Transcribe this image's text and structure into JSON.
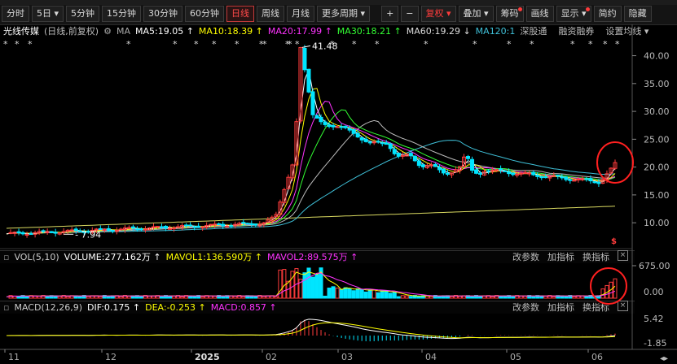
{
  "toolbar": {
    "buttons": [
      {
        "label": "分时"
      },
      {
        "label": "5日 ▾"
      },
      {
        "label": "5分钟"
      },
      {
        "label": "15分钟"
      },
      {
        "label": "30分钟"
      },
      {
        "label": "60分钟"
      },
      {
        "label": "日线",
        "active": true
      },
      {
        "label": "周线"
      },
      {
        "label": "月线"
      },
      {
        "label": "更多周期 ▾"
      }
    ],
    "tools": [
      {
        "label": "+"
      },
      {
        "label": "−"
      },
      {
        "label": "复权 ▾",
        "red": true
      },
      {
        "label": "叠加 ▾"
      },
      {
        "label": "筹码",
        "dot": true
      },
      {
        "label": "画线"
      },
      {
        "label": "显示 ▾",
        "dot": true
      },
      {
        "label": "简约"
      },
      {
        "label": "隐藏"
      }
    ]
  },
  "legend": {
    "stock": "光线传媒",
    "mode": "(日线,前复权)",
    "gear": "⚙",
    "ma": "MA",
    "ma5": "MA5:19.05 ↑",
    "ma10": "MA10:18.39 ↑",
    "ma20": "MA20:17.99 ↑",
    "ma30": "MA30:18.21 ↑",
    "ma60": "MA60:19.29 ↓",
    "ma120": "MA120:1",
    "t1": "深股通",
    "t2": "融资融券",
    "t3": "设置均线 ▾"
  },
  "vol_panel": {
    "name": "VOL(5,10)",
    "volume": "VOLUME:277.162万 ↑",
    "mavol1": "MAVOL1:136.590万 ↑",
    "mavol2": "MAVOL2:89.575万 ↑",
    "tools": [
      "改参数",
      "加指标",
      "换指标"
    ],
    "close": "×"
  },
  "macd_panel": {
    "name": "MACD(12,26,9)",
    "dif": "DIF:0.175 ↑",
    "dea": "DEA:-0.253 ↑",
    "macd": "MACD:0.857 ↑",
    "tools": [
      "改参数",
      "加指标",
      "换指标"
    ],
    "close": "×"
  },
  "annotations": {
    "high": "41.48",
    "low": "7.94",
    "s_marker": "$"
  },
  "colors": {
    "up": "#ff3c3c",
    "down": "#00e5ff",
    "ma5": "#ffffff",
    "ma10": "#ffff00",
    "ma20": "#ff33ff",
    "ma30": "#33ff33",
    "ma60": "#bbbbbb",
    "ma120": "#3fc0d8",
    "ma250": "#d8d860"
  },
  "chart_data": [
    {
      "type": "line",
      "subtype": "candlestick",
      "title": "光线传媒 (日线,前复权)",
      "x": [
        "11",
        "12",
        "2025",
        "02",
        "03",
        "04",
        "05",
        "06"
      ],
      "y_ticks": [
        "40.00",
        "35.00",
        "30.00",
        "25.00",
        "20.00",
        "15.00",
        "10.00"
      ],
      "ylim": [
        5.5,
        43
      ],
      "series": [
        {
          "name": "Close",
          "values": [
            8.3,
            8.6,
            9.0,
            9.1,
            9.3,
            9.6,
            10.0,
            16.5,
            41.48,
            28.0,
            25.5,
            23.5,
            23.2,
            22.0,
            19.5,
            20.8,
            19.5,
            18.5,
            18.0,
            17.5,
            17.6,
            21.0
          ]
        },
        {
          "name": "MA5",
          "values": [
            19.05
          ]
        },
        {
          "name": "MA10",
          "values": [
            18.39
          ]
        },
        {
          "name": "MA20",
          "values": [
            17.99
          ]
        },
        {
          "name": "MA30",
          "values": [
            18.21
          ]
        },
        {
          "name": "MA60",
          "values": [
            19.29
          ]
        }
      ],
      "high": 41.48,
      "low": 7.94
    },
    {
      "type": "bar",
      "title": "VOL(5,10)",
      "y_ticks": [
        "675.00",
        "0.00"
      ],
      "series": [
        {
          "name": "VOLUME",
          "values": [
            277.162
          ]
        },
        {
          "name": "MAVOL1",
          "values": [
            136.59
          ]
        },
        {
          "name": "MAVOL2",
          "values": [
            89.575
          ]
        }
      ]
    },
    {
      "type": "bar",
      "title": "MACD(12,26,9)",
      "y_ticks": [
        "5.42",
        "-1.85"
      ],
      "series": [
        {
          "name": "DIF",
          "values": [
            0.175
          ]
        },
        {
          "name": "DEA",
          "values": [
            -0.253
          ]
        },
        {
          "name": "MACD",
          "values": [
            0.857
          ]
        }
      ]
    }
  ]
}
